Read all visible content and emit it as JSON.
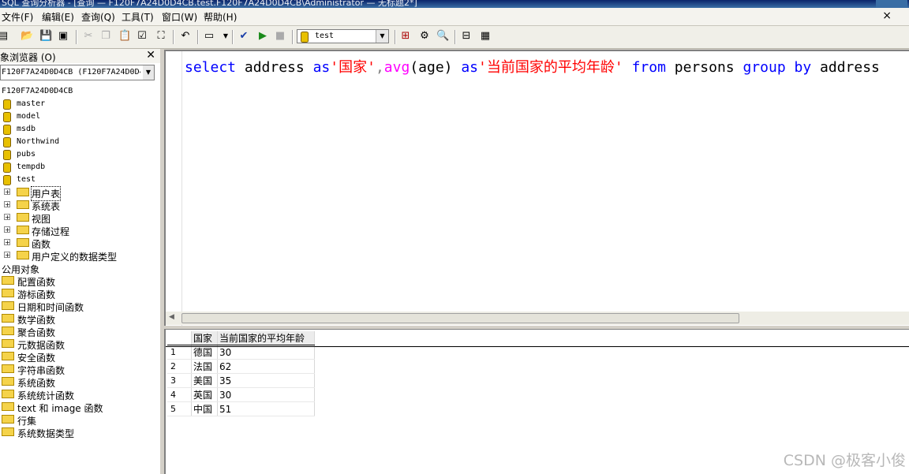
{
  "window": {
    "title": "SQL 查询分析器 - [查询 — F120F7A24D0D4CB.test.F120F7A24D0D4CB\\Administrator — 无标题2*]"
  },
  "menu": [
    "文件(F)",
    "编辑(E)",
    "查询(Q)",
    "工具(T)",
    "窗口(W)",
    "帮助(H)"
  ],
  "toolbar": {
    "database": "test"
  },
  "object_browser": {
    "title": "对象浏览器 (O)",
    "server_combo": "F120F7A24D0D4CB (F120F7A24D0D4CB\\Administrator)",
    "server": "F120F7A24D0D4CB",
    "databases": [
      "master",
      "model",
      "msdb",
      "Northwind",
      "pubs",
      "tempdb",
      "test"
    ],
    "test_children": [
      "用户表",
      "系统表",
      "视图",
      "存储过程",
      "函数",
      "用户定义的数据类型"
    ],
    "common_objects": "公用对象",
    "common_children": [
      "配置函数",
      "游标函数",
      "日期和时间函数",
      "数学函数",
      "聚合函数",
      "元数据函数",
      "安全函数",
      "字符串函数",
      "系统函数",
      "系统统计函数",
      "text 和 image 函数",
      "行集",
      "系统数据类型"
    ]
  },
  "query": {
    "t1": "select",
    "t2": " address ",
    "t3": "as",
    "t4": "'国家'",
    "t5": ",",
    "t6": "avg",
    "t7": "(age) ",
    "t8": "as",
    "t9": "'当前国家的平均年龄'",
    "t10": " ",
    "t11": "from",
    "t12": " persons ",
    "t13": "group",
    "t14": " ",
    "t15": "by",
    "t16": " address"
  },
  "results": {
    "columns": [
      "国家",
      "当前国家的平均年龄"
    ],
    "rows": [
      {
        "n": "1",
        "country": "德国",
        "avg": "30"
      },
      {
        "n": "2",
        "country": "法国",
        "avg": "62"
      },
      {
        "n": "3",
        "country": "美国",
        "avg": "35"
      },
      {
        "n": "4",
        "country": "英国",
        "avg": "30"
      },
      {
        "n": "5",
        "country": "中国",
        "avg": "51"
      }
    ]
  },
  "watermark": "CSDN @极客小俊"
}
